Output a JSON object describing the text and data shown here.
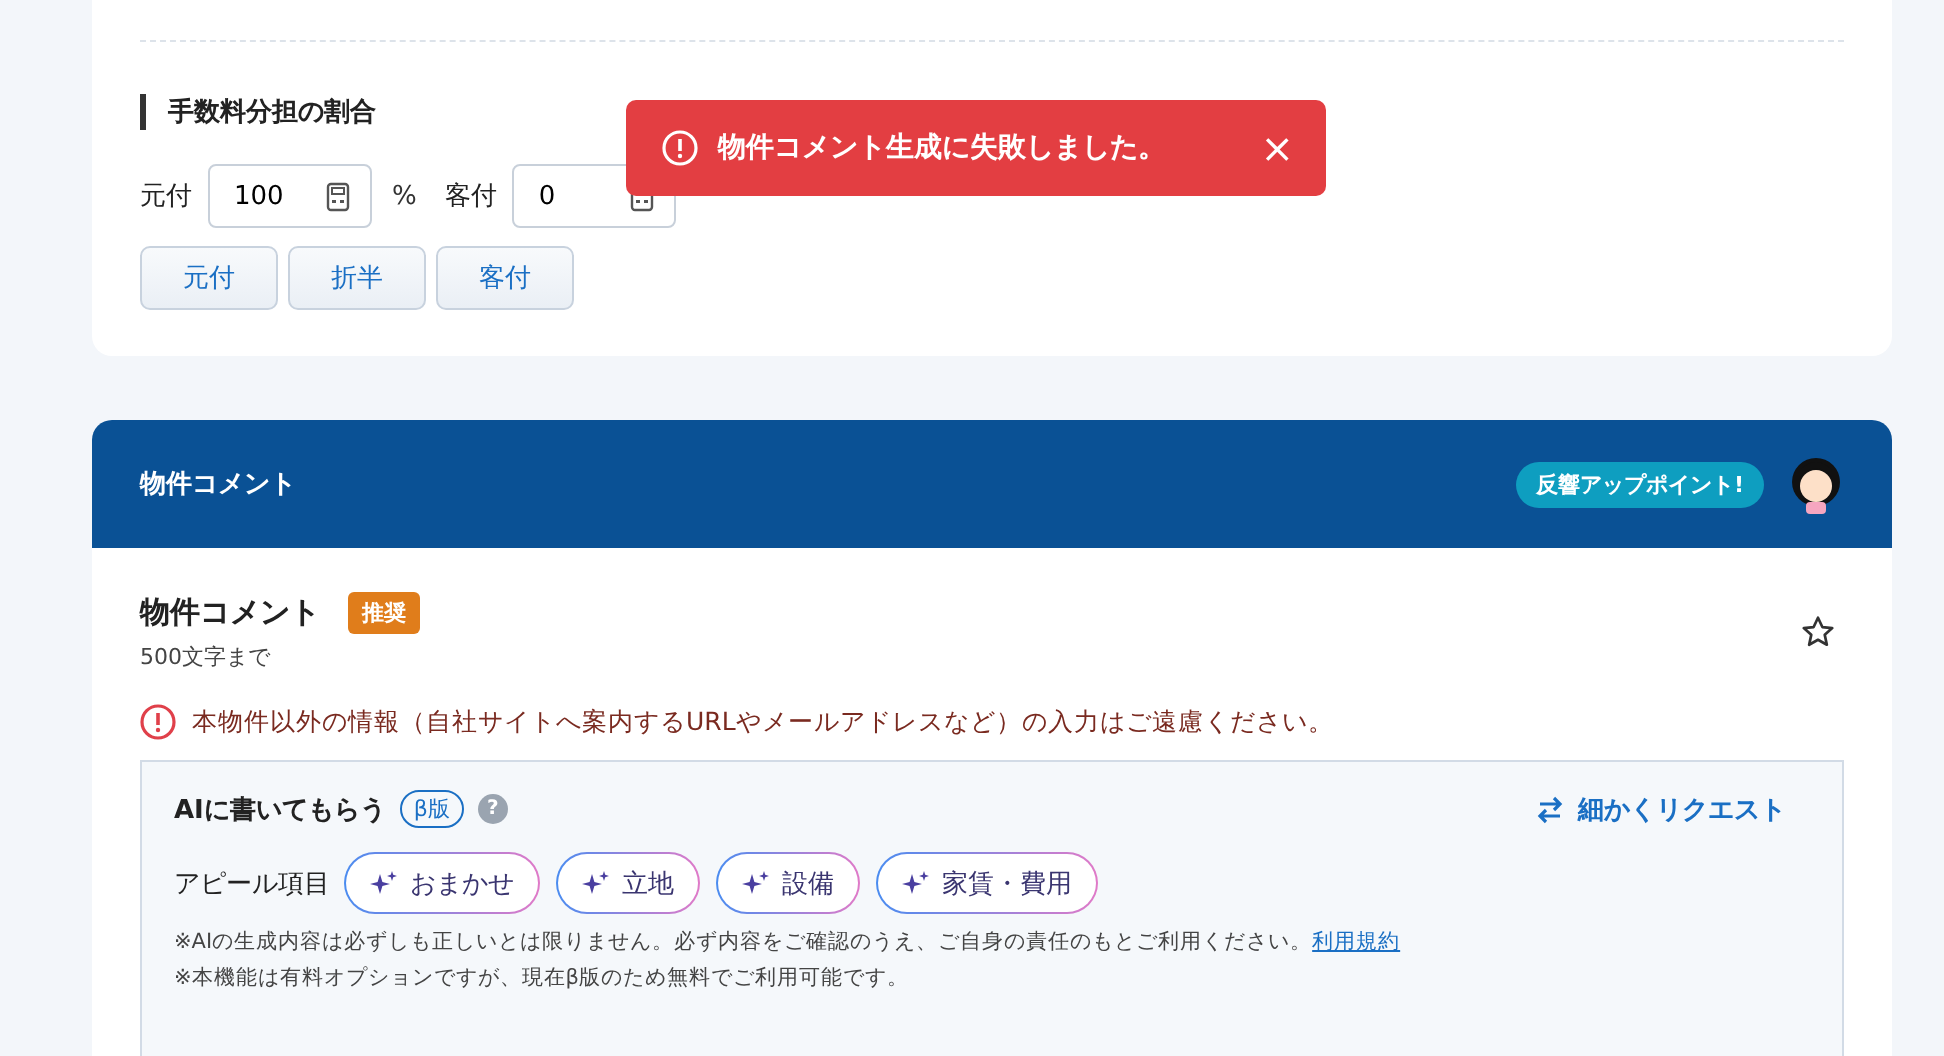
{
  "fee_share": {
    "heading": "手数料分担の割合",
    "fields": [
      {
        "label": "元付",
        "value": "100",
        "unit": "%"
      },
      {
        "label": "客付",
        "value": "0"
      }
    ],
    "buttons": [
      "元付",
      "折半",
      "客付"
    ]
  },
  "toast": {
    "message": "物件コメント生成に失敗しました。",
    "close": "×"
  },
  "comment_section": {
    "header": "物件コメント",
    "tip_bubble": "反響アップポイント!",
    "title": "物件コメント",
    "badge": "推奨",
    "limit": "500文字まで",
    "favorite": false,
    "warning": "本物件以外の情報（自社サイトへ案内するURLやメールアドレスなど）の入力はご遠慮ください。",
    "ai": {
      "title": "AIに書いてもらう",
      "beta_badge": "β版",
      "help": "?",
      "request_link": "細かくリクエスト",
      "appeal_label": "アピール項目",
      "chips": [
        {
          "label": "おまかせ"
        },
        {
          "label": "立地"
        },
        {
          "label": "設備"
        },
        {
          "label": "家賃・費用"
        }
      ],
      "note_1": "※AIの生成内容は必ずしも正しいとは限りません。必ず内容をご確認のうえ、ご自身の責任のもとご利用ください。",
      "terms_link": "利用規約",
      "note_2": "※本機能は有料オプションですが、現在β版のため無料でご利用可能です。"
    }
  }
}
